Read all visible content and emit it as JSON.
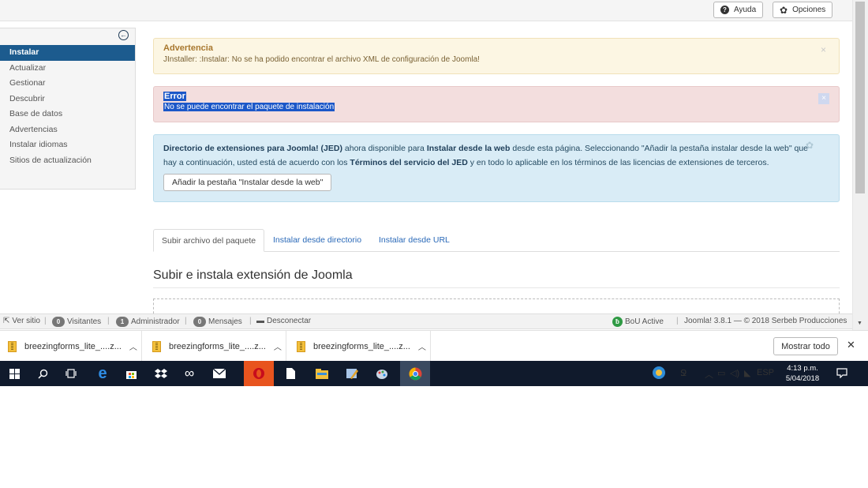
{
  "toolbar": {
    "help_label": "Ayuda",
    "options_label": "Opciones"
  },
  "sidebar": {
    "items": [
      {
        "label": "Instalar",
        "active": true
      },
      {
        "label": "Actualizar"
      },
      {
        "label": "Gestionar"
      },
      {
        "label": "Descubrir"
      },
      {
        "label": "Base de datos"
      },
      {
        "label": "Advertencias"
      },
      {
        "label": "Instalar idiomas"
      },
      {
        "label": "Sitios de actualización"
      }
    ]
  },
  "alerts": {
    "warning": {
      "title": "Advertencia",
      "message": "JInstaller: :Instalar: No se ha podido encontrar el archivo XML de configuración de Joomla!"
    },
    "error": {
      "title": "Error",
      "message": "No se puede encontrar el paquete de instalación"
    },
    "info": {
      "part1": "Directorio de extensiones para Joomla! (JED)",
      "part2": " ahora disponible para ",
      "part3": "Instalar desde la web",
      "part4": " desde esta página. Seleccionando \"Añadir la pestaña instalar desde la web\" que",
      "part5": "hay a continuación, usted está de acuerdo con los ",
      "part6": "Términos del servicio del JED",
      "part7": " y en todo lo aplicable en los términos de las licencias de extensiones de terceros.",
      "button_label": "Añadir la pestaña \"Instalar desde la web\""
    }
  },
  "tabs": [
    {
      "label": "Subir archivo del paquete",
      "active": true
    },
    {
      "label": "Instalar desde directorio"
    },
    {
      "label": "Instalar desde URL"
    }
  ],
  "section": {
    "title": "Subir e instala extensión de Joomla"
  },
  "statusbar": {
    "view_site": "Ver sitio",
    "visitors_count": "0",
    "visitors_label": "Visitantes",
    "admins_count": "1",
    "admins_label": "Administrador",
    "messages_count": "0",
    "messages_label": "Mensajes",
    "logout_label": "Desconectar",
    "bou_label": "BoU Active",
    "version_text": "Joomla! 3.8.1 — © 2018 Serbeb Producciones"
  },
  "downloads": {
    "items": [
      {
        "name": "breezingforms_lite_....z..."
      },
      {
        "name": "breezingforms_lite_....z..."
      },
      {
        "name": "breezingforms_lite_....z..."
      }
    ],
    "show_all_label": "Mostrar todo"
  },
  "taskbar": {
    "language": "ESP",
    "time": "4:13 p.m.",
    "date": "5/04/2018"
  },
  "colors": {
    "active_nav": "#1c5b8e",
    "link": "#2a69b8",
    "taskbar": "#101a2c",
    "selection": "#1b57c8"
  }
}
